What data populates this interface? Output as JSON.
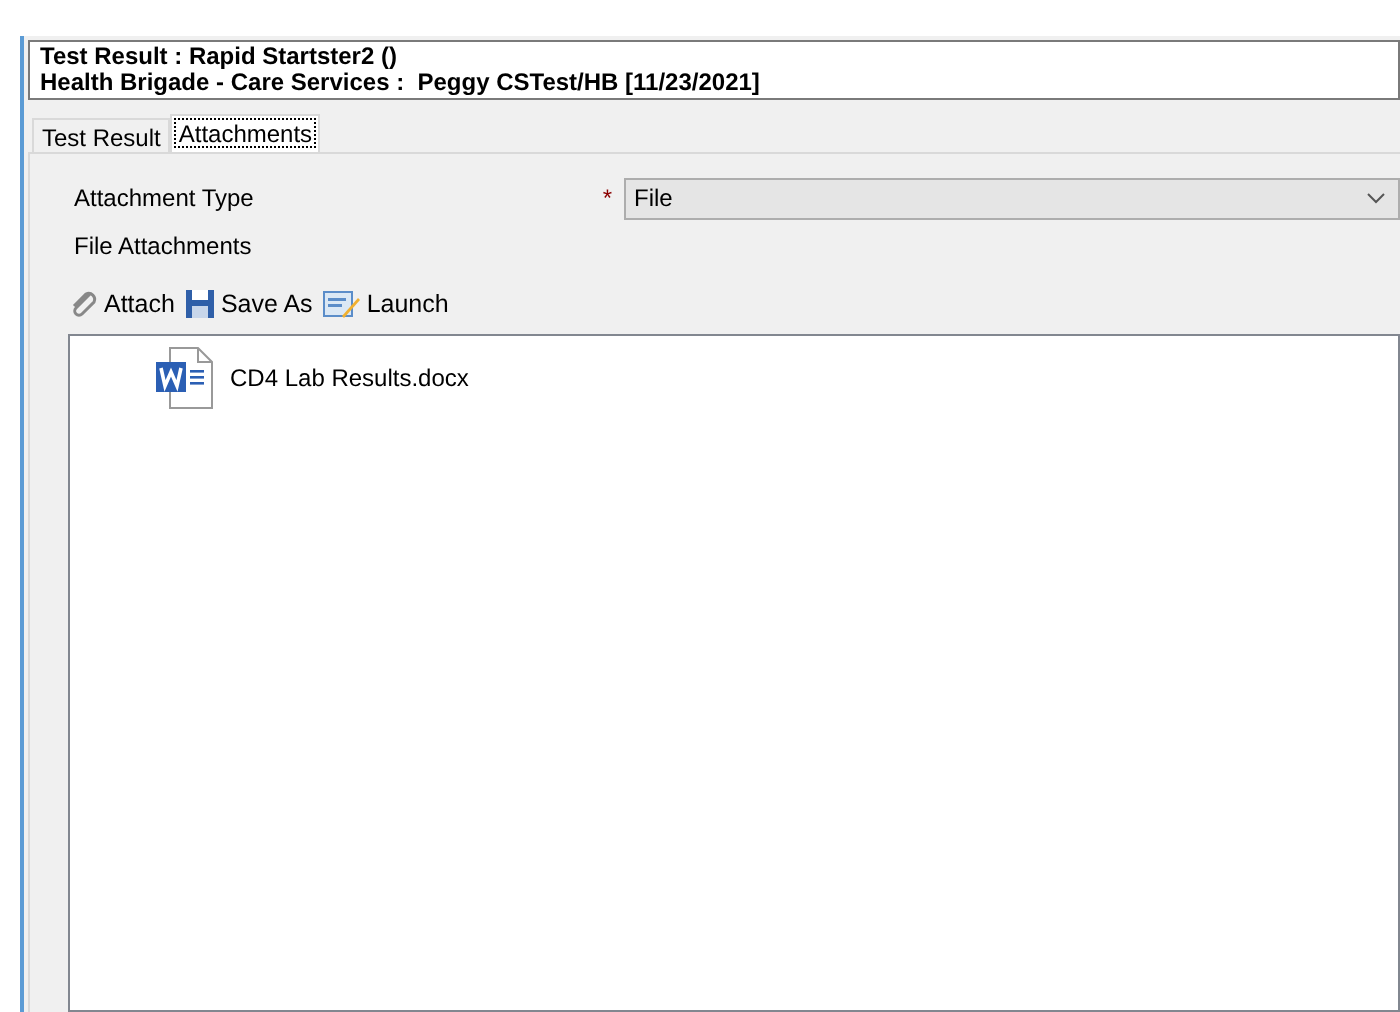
{
  "header": {
    "lines": [
      "Test Result : Rapid Startster2 ()",
      "Health Brigade - Care Services :  Peggy CSTest/HB [11/23/2021]"
    ]
  },
  "tabs": [
    {
      "label": "Test Result",
      "selected": false
    },
    {
      "label": "Attachments",
      "selected": true
    }
  ],
  "form": {
    "attachment_type": {
      "label": "Attachment Type",
      "required": true,
      "required_mark": "*",
      "value": "File"
    },
    "file_attachments_label": "File Attachments"
  },
  "toolbar": [
    {
      "kind": "attach",
      "label": "Attach"
    },
    {
      "kind": "save",
      "label": "Save As"
    },
    {
      "kind": "launch",
      "label": "Launch"
    }
  ],
  "files": [
    {
      "kind": "word",
      "name": "CD4 Lab Results.docx"
    }
  ]
}
